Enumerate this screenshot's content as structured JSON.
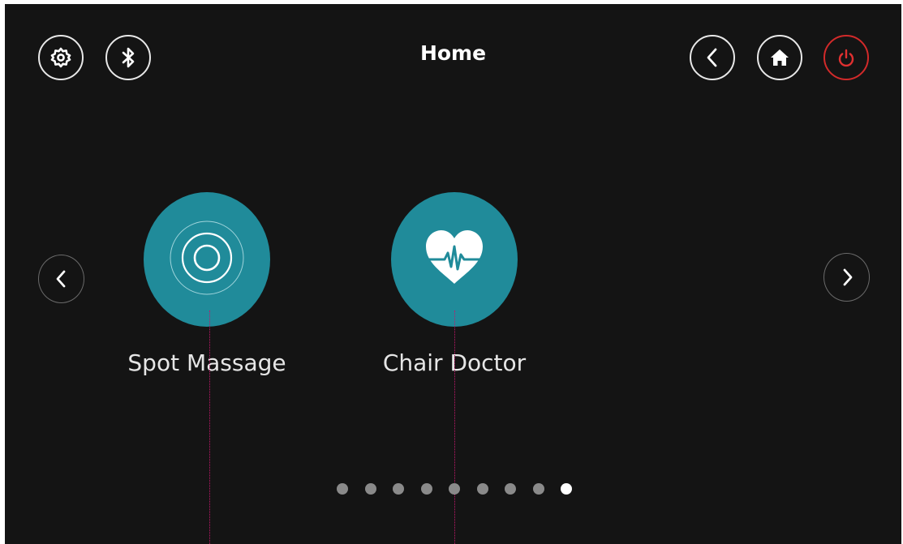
{
  "header": {
    "title": "Home",
    "icons": {
      "settings": "gear-icon",
      "bluetooth": "bluetooth-icon",
      "back": "chevron-left-icon",
      "home": "home-icon",
      "power": "power-icon"
    }
  },
  "carousel": {
    "prev_icon": "chevron-left-icon",
    "next_icon": "chevron-right-icon",
    "items": [
      {
        "label": "Spot Massage",
        "icon": "concentric-rings-icon"
      },
      {
        "label": "Chair Doctor",
        "icon": "heartbeat-heart-icon"
      }
    ],
    "page_count": 9,
    "current_page": 9
  },
  "colors": {
    "background": "#141414",
    "accent": "#208b9a",
    "power": "#d22a2a",
    "dot_inactive": "#8a8a8a",
    "dot_active": "#ffffff"
  }
}
